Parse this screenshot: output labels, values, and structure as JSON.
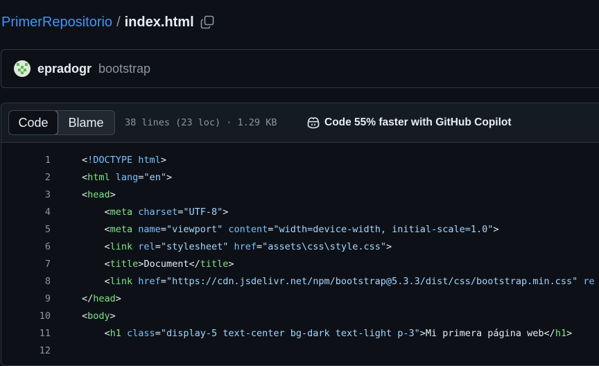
{
  "breadcrumb": {
    "repo": "PrimerRepositorio",
    "separator": "/",
    "file": "index.html"
  },
  "commit": {
    "author": "epradogr",
    "message": "bootstrap"
  },
  "file_header": {
    "tabs": [
      "Code",
      "Blame"
    ],
    "active_tab": "Code",
    "meta": "38 lines (23 loc) · 1.29 KB",
    "copilot_text": "Code 55% faster with GitHub Copilot"
  },
  "code": {
    "lines": [
      {
        "n": "1",
        "text": "<!DOCTYPE html>"
      },
      {
        "n": "2",
        "text": "<html lang=\"en\">"
      },
      {
        "n": "3",
        "text": "<head>"
      },
      {
        "n": "4",
        "text": "    <meta charset=\"UTF-8\">"
      },
      {
        "n": "5",
        "text": "    <meta name=\"viewport\" content=\"width=device-width, initial-scale=1.0\">"
      },
      {
        "n": "6",
        "text": "    <link rel=\"stylesheet\" href=\"assets\\css\\style.css\">"
      },
      {
        "n": "7",
        "text": "    <title>Document</title>"
      },
      {
        "n": "8",
        "text": "    <link href=\"https://cdn.jsdelivr.net/npm/bootstrap@5.3.3/dist/css/bootstrap.min.css\" re"
      },
      {
        "n": "9",
        "text": "</head>"
      },
      {
        "n": "10",
        "text": "<body>"
      },
      {
        "n": "11",
        "text": "    <h1 class=\"display-5 text-center bg-dark text-light p-3\">Mi primera página web</h1>"
      },
      {
        "n": "12",
        "text": ""
      }
    ]
  },
  "colors": {
    "background": "#0d1117",
    "link": "#4493f8",
    "tag": "#7ee787",
    "attr": "#79c0ff",
    "string": "#a5d6ff",
    "muted": "#8d96a0"
  },
  "icons": {
    "copy": "copy-icon",
    "copilot": "copilot-icon",
    "avatar": "identicon"
  }
}
